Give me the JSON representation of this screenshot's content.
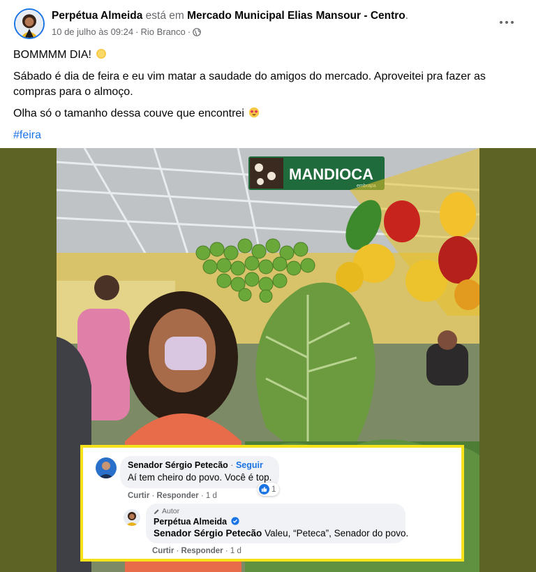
{
  "post": {
    "author": "Perpétua Almeida",
    "at_text": "está em",
    "location": "Mercado Municipal Elias Mansour - Centro",
    "location_suffix": ".",
    "date": "10 de julho às 09:24",
    "separator": "·",
    "place": "Rio Branco",
    "privacy_icon": "globe-icon",
    "more_icon": "more-options-icon",
    "text": {
      "line1": "BOMMMM DIA!",
      "line2": "Sábado é dia de feira e eu vim matar a saudade do amigos do mercado. Aproveitei pra fazer as compras para o almoço.",
      "line3": "Olha só o tamanho dessa couve que encontrei",
      "hashtag": "#feira"
    },
    "emoji1": "sun-emoji-icon",
    "emoji2": "star-struck-emoji-icon"
  },
  "photo": {
    "sign_text": "MANDIOCA",
    "sign_subtext": "embrapa"
  },
  "comments": [
    {
      "name": "Senador Sérgio Petecão",
      "follow_sep": "·",
      "follow": "Seguir",
      "text": "Aí tem cheiro do povo. Você é top.",
      "like": "Curtir",
      "reply": "Responder",
      "time": "1 d",
      "reaction_count": "1"
    },
    {
      "badge": "Autor",
      "name": "Perpétua Almeida",
      "mention": "Senador Sérgio Petecão",
      "text": "Valeu, “Peteca”, Senador do povo.",
      "like": "Curtir",
      "reply": "Responder",
      "time": "1 d"
    }
  ],
  "colors": {
    "link": "#1b74e4",
    "muted": "#65676b",
    "highlight_border": "#f5e21b",
    "photo_background": "#5c6324"
  }
}
